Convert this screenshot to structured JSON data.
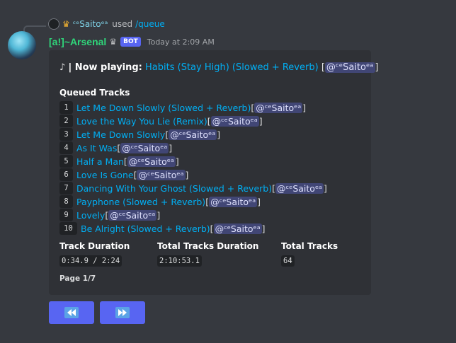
{
  "reply": {
    "username": "ᶜᵉSaitoᵉᵃ",
    "used_text": "used",
    "command": "/queue",
    "icons": [
      "avatar-icon",
      "crown-icon"
    ]
  },
  "message": {
    "author": "[a!]~Arsenal",
    "bot_badge": "BOT",
    "timestamp": "Today at 2:09 AM"
  },
  "embed": {
    "now_playing_icon": "♪",
    "now_playing_label": "| Now playing:",
    "now_playing_title": "Habits (Stay High) (Slowed + Reverb)",
    "now_playing_mention": "@ᶜᵉSaitoᵉᵃ",
    "queued_header": "Queued Tracks",
    "tracks": [
      {
        "num": "1",
        "title": "Let Me Down Slowly (Slowed + Reverb)",
        "mention": "@ᶜᵉSaitoᵉᵃ"
      },
      {
        "num": "2",
        "title": "Love the Way You Lie (Remix)",
        "mention": "@ᶜᵉSaitoᵉᵃ"
      },
      {
        "num": "3",
        "title": "Let Me Down Slowly",
        "mention": "@ᶜᵉSaitoᵉᵃ"
      },
      {
        "num": "4",
        "title": "As It Was",
        "mention": "@ᶜᵉSaitoᵉᵃ"
      },
      {
        "num": "5",
        "title": "Half a Man",
        "mention": "@ᶜᵉSaitoᵉᵃ"
      },
      {
        "num": "6",
        "title": "Love Is Gone",
        "mention": "@ᶜᵉSaitoᵉᵃ"
      },
      {
        "num": "7",
        "title": "Dancing With Your Ghost (Slowed + Reverb)",
        "mention": "@ᶜᵉSaitoᵉᵃ"
      },
      {
        "num": "8",
        "title": "Payphone (Slowed + Reverb)",
        "mention": "@ᶜᵉSaitoᵉᵃ"
      },
      {
        "num": "9",
        "title": "Lovely",
        "mention": "@ᶜᵉSaitoᵉᵃ"
      },
      {
        "num": "10",
        "title": "Be Alright (Slowed + Reverb)",
        "mention": "@ᶜᵉSaitoᵉᵃ"
      }
    ],
    "fields": [
      {
        "name": "Track Duration",
        "value": "0:34.9 / 2:24"
      },
      {
        "name": "Total Tracks Duration",
        "value": "2:10:53.1"
      },
      {
        "name": "Total Tracks",
        "value": "64"
      }
    ],
    "footer": "Page 1/7"
  },
  "buttons": [
    {
      "icon": "rewind-icon",
      "label": "previous page"
    },
    {
      "icon": "fast-forward-icon",
      "label": "next page"
    }
  ],
  "colors": {
    "background": "#36393f",
    "embed": "#2f3136",
    "link": "#00aff4",
    "author": "#2fd67a",
    "blurple": "#5865f2"
  }
}
